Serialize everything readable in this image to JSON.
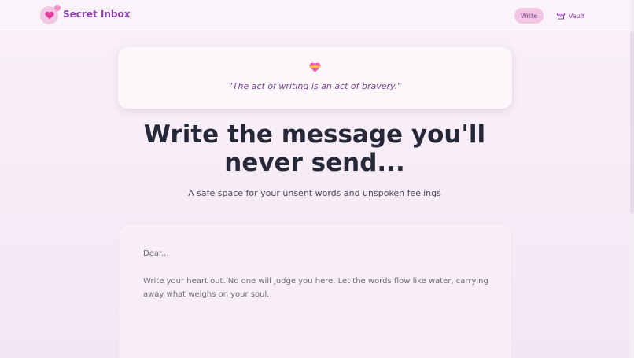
{
  "header": {
    "brand": "Secret Inbox",
    "logo_icon": "heart-icon",
    "nav": {
      "write_label": "Write",
      "vault_label": "Vault",
      "vault_icon": "archive-box-icon"
    }
  },
  "quote": {
    "icon": "heart-with-ribbon-icon",
    "text": "\"The act of writing is an act of bravery.\""
  },
  "hero": {
    "title": "Write the message you'll never send...",
    "subtitle": "A safe space for your unsent words and unspoken feelings"
  },
  "editor": {
    "salutation_placeholder": "Dear...",
    "body_placeholder": "Write your heart out. No one will judge you here. Let the words flow like water, carrying away what weighs on your soul."
  },
  "colors": {
    "accent": "#8e3fb1",
    "pink": "#f2c6e3",
    "heart": "#e0409c",
    "background": "#f8f0f8"
  }
}
